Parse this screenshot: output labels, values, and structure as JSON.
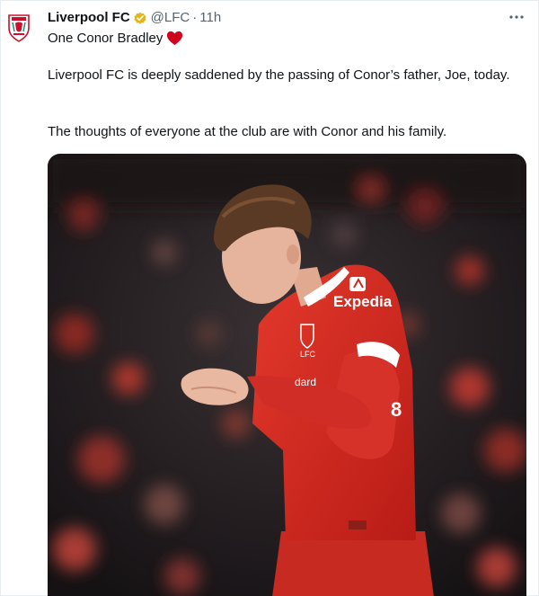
{
  "tweet": {
    "author": {
      "name": "Liverpool FC",
      "handle": "@LFC",
      "separator": "·",
      "time": "11h",
      "verified_badge_color": "#e2b719"
    },
    "line1": "One Conor Bradley",
    "paragraph1": "Liverpool FC is deeply saddened by the passing of Conor’s father, Joe, today.",
    "paragraph2": "The thoughts of everyone at the club are with Conor and his family.",
    "more_icon": "more-horizontal-icon",
    "heart_color": "#d0021b",
    "media": {
      "kit_sponsor": "Expedia",
      "kit_text_partial": "dard",
      "shirt_number_partial": "8",
      "club_crest_text": "LFC",
      "kit_color": "#d5281f"
    }
  }
}
